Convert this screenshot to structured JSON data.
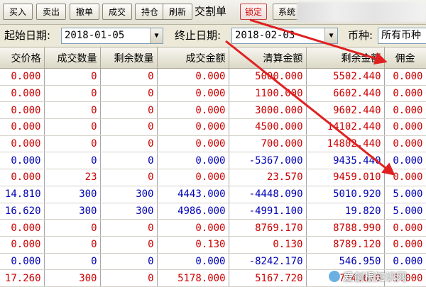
{
  "toolbar": {
    "buttons": [
      "买入",
      "卖出",
      "撤单",
      "成交",
      "持仓",
      "刷新"
    ],
    "title": "交割单",
    "lock_label": "锁定",
    "system_label": "系统"
  },
  "filter": {
    "start_label": "起始日期:",
    "start_value": "2018-01-05",
    "end_label": "终止日期:",
    "end_value": "2018-02-03",
    "currency_label": "币种:",
    "currency_value": "所有币种"
  },
  "table": {
    "columns": [
      "交价格",
      "成交数量",
      "剩余数量",
      "成交金额",
      "清算金额",
      "剩余金额",
      "佣金"
    ],
    "rows": [
      {
        "color": "red",
        "cells": [
          "0.000",
          "0",
          "0",
          "0.000",
          "5000.000",
          "5502.440",
          "0.000"
        ]
      },
      {
        "color": "red",
        "cells": [
          "0.000",
          "0",
          "0",
          "0.000",
          "1100.000",
          "6602.440",
          "0.000"
        ]
      },
      {
        "color": "red",
        "cells": [
          "0.000",
          "0",
          "0",
          "0.000",
          "3000.000",
          "9602.440",
          "0.000"
        ]
      },
      {
        "color": "red",
        "cells": [
          "0.000",
          "0",
          "0",
          "0.000",
          "4500.000",
          "14102.440",
          "0.000"
        ]
      },
      {
        "color": "red",
        "cells": [
          "0.000",
          "0",
          "0",
          "0.000",
          "700.000",
          "14802.440",
          "0.000"
        ]
      },
      {
        "color": "blue",
        "cells": [
          "0.000",
          "0",
          "0",
          "0.000",
          "-5367.000",
          "9435.440",
          "0.000"
        ]
      },
      {
        "color": "red",
        "cells": [
          "0.000",
          "23",
          "0",
          "0.000",
          "23.570",
          "9459.010",
          "0.000"
        ]
      },
      {
        "color": "blue",
        "cells": [
          "14.810",
          "300",
          "300",
          "4443.000",
          "-4448.090",
          "5010.920",
          "5.000"
        ]
      },
      {
        "color": "blue",
        "cells": [
          "16.620",
          "300",
          "300",
          "4986.000",
          "-4991.100",
          "19.820",
          "5.000"
        ]
      },
      {
        "color": "red",
        "cells": [
          "0.000",
          "0",
          "0",
          "0.000",
          "8769.170",
          "8788.990",
          "0.000"
        ]
      },
      {
        "color": "red",
        "cells": [
          "0.000",
          "0",
          "0",
          "0.130",
          "0.130",
          "8789.120",
          "0.000"
        ]
      },
      {
        "color": "blue",
        "cells": [
          "0.000",
          "0",
          "0",
          "0.000",
          "-8242.170",
          "546.950",
          "0.000"
        ]
      },
      {
        "color": "red",
        "cells": [
          "17.260",
          "300",
          "0",
          "5178.000",
          "5167.720",
          "5714.670",
          "5.000"
        ]
      }
    ]
  },
  "watermark": "爱创根知识网",
  "colors": {
    "buy_row": "#cc0000",
    "sell_row": "#0000b4",
    "annotation_arrow": "#e02020"
  }
}
